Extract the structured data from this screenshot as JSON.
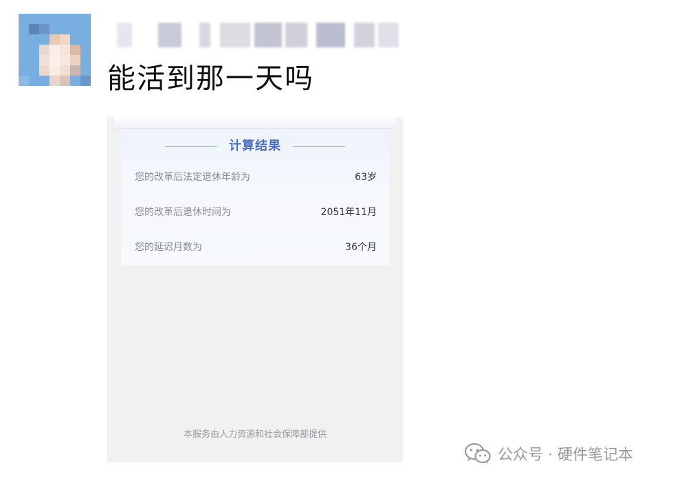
{
  "message": {
    "text": "能活到那一天吗"
  },
  "screenshot": {
    "result_title": "计算结果",
    "rows": [
      {
        "label": "您的改革后法定退休年龄为",
        "value": "63岁"
      },
      {
        "label": "您的改革后退休时间为",
        "value": "2051年11月"
      },
      {
        "label": "您的延迟月数为",
        "value": "36个月"
      }
    ],
    "footer": "本服务由人力资源和社会保障部提供"
  },
  "watermark": {
    "text": "公众号 · 硬件笔记本",
    "icon": "wechat-icon"
  },
  "colors": {
    "accent": "#4a6fc0",
    "card_bg": "#f1f1f2",
    "panel_bg": "#eef3fc"
  }
}
